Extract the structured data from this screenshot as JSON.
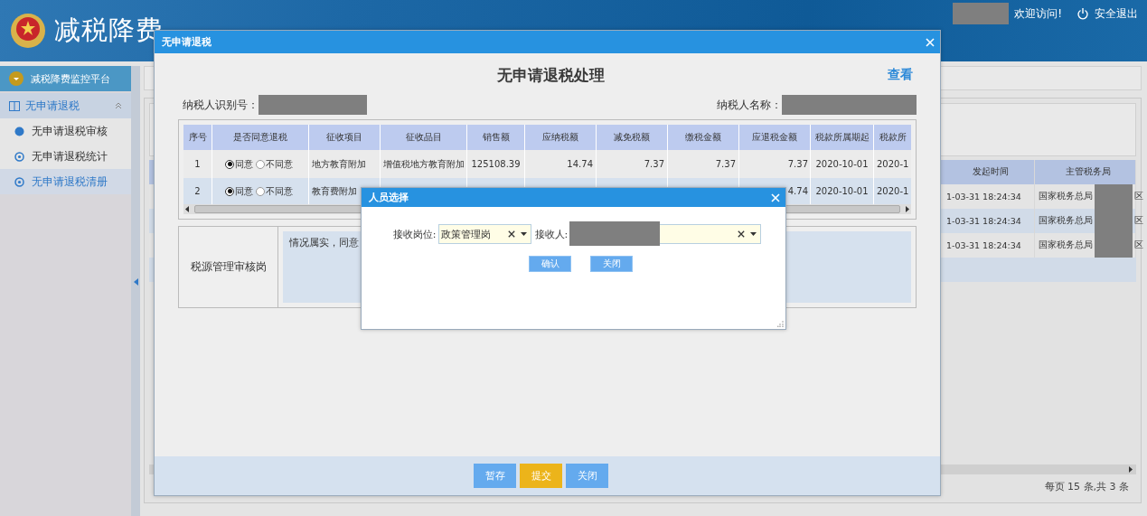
{
  "header": {
    "title": "减税降费",
    "welcome": "欢迎访问!",
    "logout": "安全退出"
  },
  "sidebar": {
    "platform": "减税降费监控平台",
    "groups": [
      {
        "label": "无申请退税",
        "expanded": true,
        "items": [
          {
            "label": "无申请退税审核",
            "selected": false
          },
          {
            "label": "无申请退税统计",
            "selected": false
          },
          {
            "label": "无申请退税清册",
            "selected": true
          }
        ]
      }
    ]
  },
  "list": {
    "columns": [
      "发起时间",
      "主管税务局"
    ],
    "rows": [
      {
        "time": "1-03-31 18:24:34",
        "bureau": "国家税务总局",
        "bureau_tail": "区"
      },
      {
        "time": "1-03-31 18:24:34",
        "bureau": "国家税务总局",
        "bureau_tail": "区"
      },
      {
        "time": "1-03-31 18:24:34",
        "bureau": "国家税务总局",
        "bureau_tail": "区"
      }
    ],
    "pager": "每页 15 条,共 3 条"
  },
  "dialog": {
    "title": "无申请退税",
    "heading": "无申请退税处理",
    "view_link": "查看",
    "taxpayer_id_label": "纳税人识别号：",
    "taxpayer_name_label": "纳税人名称：",
    "table": {
      "columns": [
        "序号",
        "是否同意退税",
        "征收项目",
        "征收品目",
        "销售额",
        "应纳税额",
        "减免税额",
        "缴税金额",
        "应退税金额",
        "税款所属期起",
        "税款所"
      ],
      "rows": [
        {
          "cells": [
            "1",
            {
              "kind": "radio",
              "options": [
                {
                  "label": "同意",
                  "selected": true
                },
                {
                  "label": "不同意",
                  "selected": false
                }
              ]
            },
            "地方教育附加",
            "增值税地方教育附加",
            "125108.39",
            "14.74",
            "7.37",
            "7.37",
            "7.37",
            "2020-10-01",
            "2020-1"
          ]
        },
        {
          "cells": [
            "2",
            {
              "kind": "radio",
              "options": [
                {
                  "label": "同意",
                  "selected": true
                },
                {
                  "label": "不同意",
                  "selected": false
                }
              ]
            },
            "教育费附加",
            null,
            null,
            null,
            null,
            null,
            "4.74",
            "2020-10-01",
            "2020-1"
          ]
        }
      ]
    },
    "review": {
      "role": "税源管理审核岗",
      "opinion": "情况属实，同意"
    },
    "buttons": [
      {
        "label": "暂存",
        "kind": "secondary"
      },
      {
        "label": "提交",
        "kind": "primary"
      },
      {
        "label": "关闭",
        "kind": "secondary"
      }
    ]
  },
  "picker": {
    "title": "人员选择",
    "post_label": "接收岗位:",
    "post_value": "政策管理岗",
    "receiver_label": "接收人:",
    "buttons": [
      "确认",
      "关闭"
    ]
  }
}
